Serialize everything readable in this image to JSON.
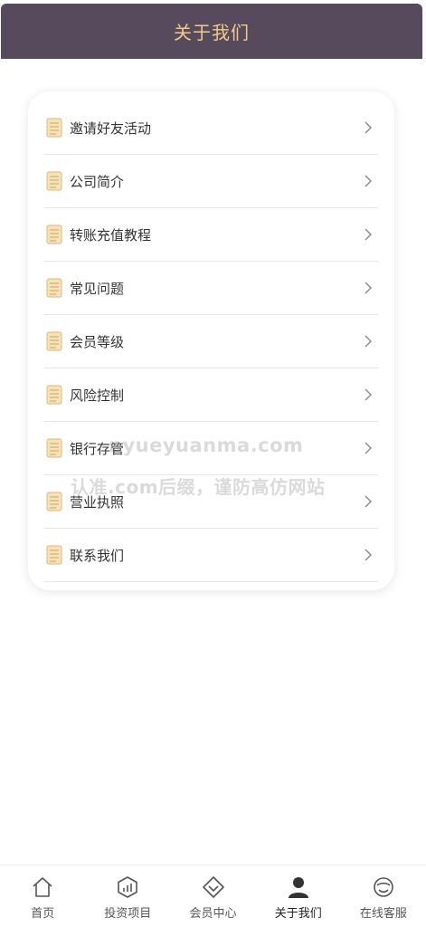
{
  "header": {
    "title": "关于我们"
  },
  "menu": {
    "items": [
      {
        "label": "邀请好友活动"
      },
      {
        "label": "公司简介"
      },
      {
        "label": "转账充值教程"
      },
      {
        "label": "常见问题"
      },
      {
        "label": "会员等级"
      },
      {
        "label": "风险控制"
      },
      {
        "label": "银行存管"
      },
      {
        "label": "营业执照"
      },
      {
        "label": "联系我们"
      }
    ],
    "item_icon": "document-icon",
    "chevron_icon": "chevron-right-icon"
  },
  "watermark": {
    "line1": "nyueyuanma.com",
    "line2": "认准.com后缀，谨防高仿网站"
  },
  "tabbar": {
    "tabs": [
      {
        "label": "首页",
        "icon": "home-icon"
      },
      {
        "label": "投资项目",
        "icon": "chart-icon"
      },
      {
        "label": "会员中心",
        "icon": "diamond-icon"
      },
      {
        "label": "关于我们",
        "icon": "user-icon",
        "active": true
      },
      {
        "label": "在线客服",
        "icon": "support-icon"
      }
    ]
  },
  "colors": {
    "header_bg": "#564a5c",
    "header_text": "#f2c98a",
    "icon_accent": "#e8c98c"
  }
}
